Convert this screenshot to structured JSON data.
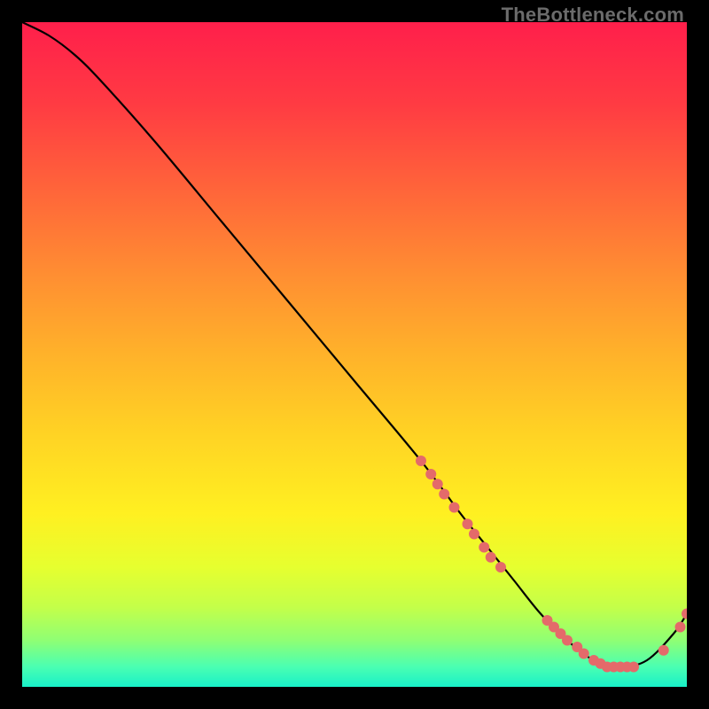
{
  "watermark": "TheBottleneck.com",
  "chart_data": {
    "type": "line",
    "title": "",
    "xlabel": "",
    "ylabel": "",
    "xlim": [
      0,
      100
    ],
    "ylim": [
      0,
      100
    ],
    "grid": false,
    "legend": false,
    "curve": {
      "x": [
        0,
        4,
        8,
        12,
        20,
        30,
        40,
        50,
        60,
        66,
        70,
        74,
        78,
        82,
        86,
        90,
        94,
        98,
        100
      ],
      "y": [
        100,
        98,
        95,
        91,
        82,
        70,
        58,
        46,
        34,
        26,
        21,
        16,
        11,
        7,
        4,
        3,
        4,
        8,
        11
      ]
    },
    "markers": {
      "color": "#e46a6a",
      "radius": 6,
      "points": [
        {
          "x": 60.0,
          "y": 34.0
        },
        {
          "x": 61.5,
          "y": 32.0
        },
        {
          "x": 62.5,
          "y": 30.5
        },
        {
          "x": 63.5,
          "y": 29.0
        },
        {
          "x": 65.0,
          "y": 27.0
        },
        {
          "x": 67.0,
          "y": 24.5
        },
        {
          "x": 68.0,
          "y": 23.0
        },
        {
          "x": 69.5,
          "y": 21.0
        },
        {
          "x": 70.5,
          "y": 19.5
        },
        {
          "x": 72.0,
          "y": 18.0
        },
        {
          "x": 79.0,
          "y": 10.0
        },
        {
          "x": 80.0,
          "y": 9.0
        },
        {
          "x": 81.0,
          "y": 8.0
        },
        {
          "x": 82.0,
          "y": 7.0
        },
        {
          "x": 83.5,
          "y": 6.0
        },
        {
          "x": 84.5,
          "y": 5.0
        },
        {
          "x": 86.0,
          "y": 4.0
        },
        {
          "x": 87.0,
          "y": 3.5
        },
        {
          "x": 88.0,
          "y": 3.0
        },
        {
          "x": 89.0,
          "y": 3.0
        },
        {
          "x": 90.0,
          "y": 3.0
        },
        {
          "x": 91.0,
          "y": 3.0
        },
        {
          "x": 92.0,
          "y": 3.0
        },
        {
          "x": 96.5,
          "y": 5.5
        },
        {
          "x": 99.0,
          "y": 9.0
        },
        {
          "x": 100.0,
          "y": 11.0
        }
      ]
    },
    "gradient_stops": [
      {
        "offset": 0.0,
        "color": "#ff1f4b"
      },
      {
        "offset": 0.12,
        "color": "#ff3a43"
      },
      {
        "offset": 0.25,
        "color": "#ff643a"
      },
      {
        "offset": 0.38,
        "color": "#ff8e32"
      },
      {
        "offset": 0.5,
        "color": "#ffb22a"
      },
      {
        "offset": 0.62,
        "color": "#ffd324"
      },
      {
        "offset": 0.74,
        "color": "#fff021"
      },
      {
        "offset": 0.82,
        "color": "#e6ff2f"
      },
      {
        "offset": 0.88,
        "color": "#c4ff49"
      },
      {
        "offset": 0.93,
        "color": "#8fff74"
      },
      {
        "offset": 0.97,
        "color": "#4affb2"
      },
      {
        "offset": 1.0,
        "color": "#18f0c8"
      }
    ]
  }
}
